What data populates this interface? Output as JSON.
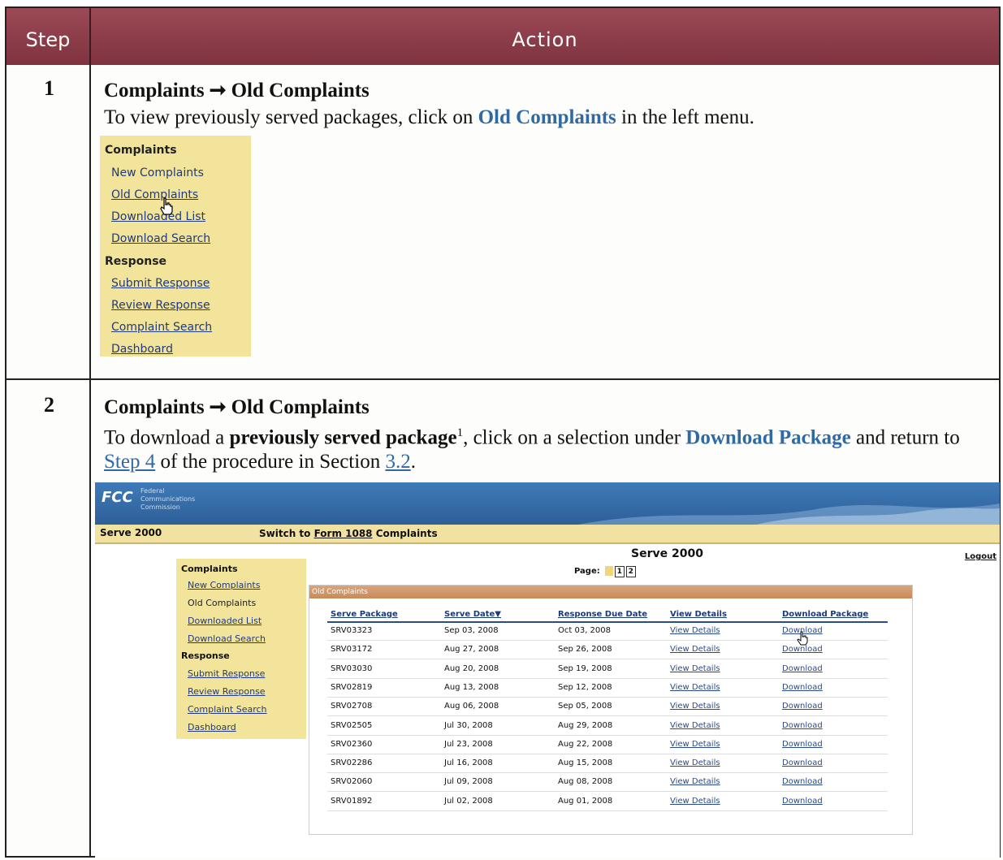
{
  "header": {
    "step": "Step",
    "action": "Action"
  },
  "steps": [
    {
      "number": "1",
      "title_a": "Complaints",
      "title_b": "Old Complaints",
      "desc_pre": "To view previously served packages, click on ",
      "desc_link": "Old Complaints",
      "desc_post": " in the left menu."
    },
    {
      "number": "2",
      "title_a": "Complaints",
      "title_b": "Old Complaints",
      "desc_1": "To download a ",
      "desc_bold": "previously served package",
      "desc_sup": "1",
      "desc_2": ", click on a selection under ",
      "desc_link": "Download Package",
      "desc_3": " and return to ",
      "desc_step_link": "Step 4",
      "desc_4": " of the procedure in Section ",
      "desc_section_link": "3.2",
      "desc_5": "."
    }
  ],
  "menu1": {
    "complaints_heading": "Complaints",
    "items_a": [
      "New Complaints",
      "Old Complaints",
      "Downloaded List",
      "Download Search"
    ],
    "response_heading": "Response",
    "items_b": [
      "Submit Response",
      "Review Response",
      "Complaint Search",
      "Dashboard"
    ]
  },
  "fcc": {
    "logo": "FCC",
    "logo_sub": [
      "Federal",
      "Communications",
      "Commission"
    ],
    "serve": "Serve 2000",
    "switch_pre": "Switch to ",
    "switch_link": "Form 1088",
    "switch_post": " Complaints",
    "page_title": "Serve 2000",
    "logout": "Logout",
    "page_label": "Page:",
    "pages": [
      "1",
      "2"
    ],
    "menu": {
      "complaints_heading": "Complaints",
      "items_a": [
        "New Complaints",
        "Old Complaints",
        "Downloaded List",
        "Download Search"
      ],
      "response_heading": "Response",
      "items_b": [
        "Submit Response",
        "Review Response",
        "Complaint Search",
        "Dashboard"
      ]
    },
    "grid_title": "Old Complaints",
    "columns": [
      "Serve Package",
      "Serve Date▼",
      "Response Due Date",
      "View Details",
      "Download Package"
    ],
    "rows": [
      [
        "SRV03323",
        "Sep 03, 2008",
        "Oct 03, 2008",
        "View Details",
        "Download"
      ],
      [
        "SRV03172",
        "Aug 27, 2008",
        "Sep 26, 2008",
        "View Details",
        "Download"
      ],
      [
        "SRV03030",
        "Aug 20, 2008",
        "Sep 19, 2008",
        "View Details",
        "Download"
      ],
      [
        "SRV02819",
        "Aug 13, 2008",
        "Sep 12, 2008",
        "View Details",
        "Download"
      ],
      [
        "SRV02708",
        "Aug 06, 2008",
        "Sep 05, 2008",
        "View Details",
        "Download"
      ],
      [
        "SRV02505",
        "Jul 30, 2008",
        "Aug 29, 2008",
        "View Details",
        "Download"
      ],
      [
        "SRV02360",
        "Jul 23, 2008",
        "Aug 22, 2008",
        "View Details",
        "Download"
      ],
      [
        "SRV02286",
        "Jul 16, 2008",
        "Aug 15, 2008",
        "View Details",
        "Download"
      ],
      [
        "SRV02060",
        "Jul 09, 2008",
        "Aug 08, 2008",
        "View Details",
        "Download"
      ],
      [
        "SRV01892",
        "Jul 02, 2008",
        "Aug 01, 2008",
        "View Details",
        "Download"
      ]
    ]
  },
  "colors": {
    "header_bg": "#8a3a47",
    "link_blue": "#2f6aa5",
    "menu_bg": "#f2e49a",
    "fcc_blue": "#2e5f98"
  }
}
